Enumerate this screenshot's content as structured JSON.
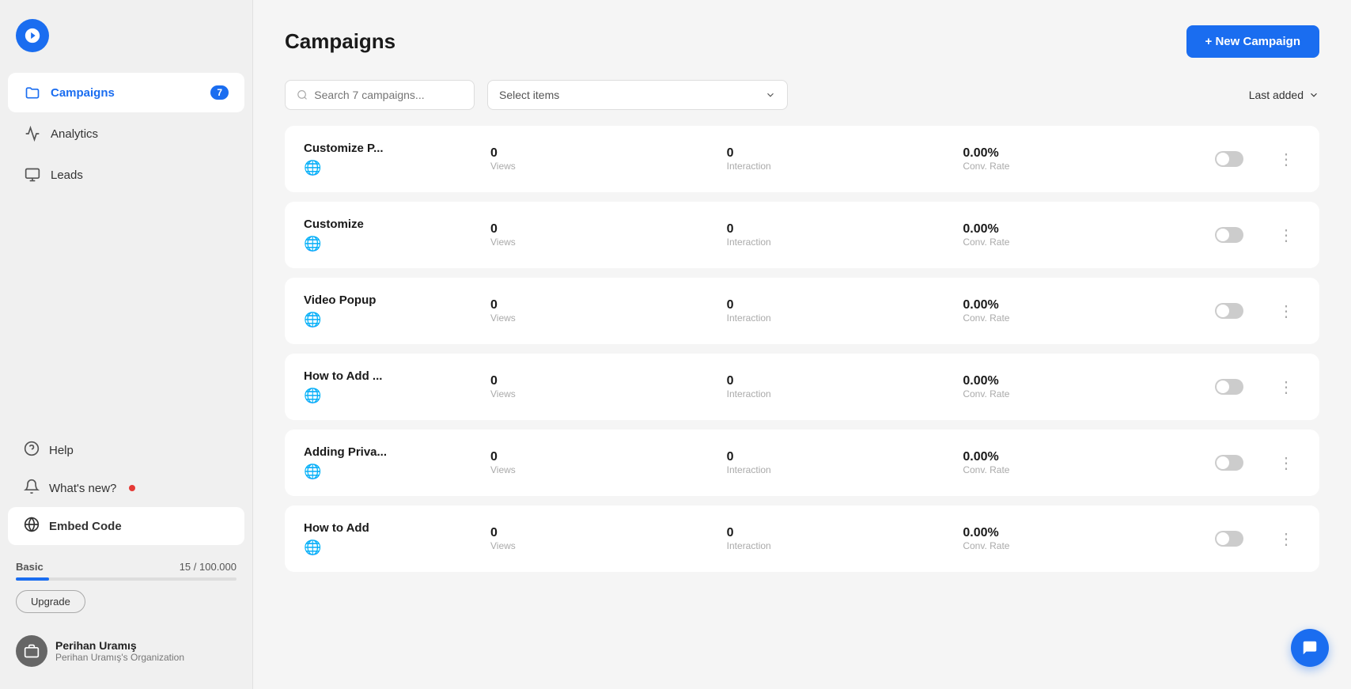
{
  "sidebar": {
    "logo_alt": "App Logo",
    "nav_items": [
      {
        "id": "campaigns",
        "label": "Campaigns",
        "icon": "folder-icon",
        "active": true,
        "badge": "7"
      },
      {
        "id": "analytics",
        "label": "Analytics",
        "icon": "analytics-icon",
        "active": false,
        "badge": null
      },
      {
        "id": "leads",
        "label": "Leads",
        "icon": "leads-icon",
        "active": false,
        "badge": null
      }
    ],
    "bottom_items": [
      {
        "id": "help",
        "label": "Help",
        "icon": "help-icon",
        "highlighted": false,
        "has_dot": false
      },
      {
        "id": "whats-new",
        "label": "What's new?",
        "icon": "bell-icon",
        "highlighted": false,
        "has_dot": true
      },
      {
        "id": "embed-code",
        "label": "Embed Code",
        "icon": "embed-icon",
        "highlighted": true,
        "has_dot": false
      }
    ],
    "plan": {
      "label": "Basic",
      "usage": "15 / 100.000",
      "progress_pct": 15,
      "upgrade_label": "Upgrade"
    },
    "user": {
      "name": "Perihan Uramış",
      "org": "Perihan Uramış's Organization"
    }
  },
  "header": {
    "title": "Campaigns",
    "new_campaign_label": "+ New Campaign"
  },
  "toolbar": {
    "search_placeholder": "Search 7 campaigns...",
    "select_placeholder": "Select items",
    "sort_label": "Last added"
  },
  "campaigns": [
    {
      "name": "Customize P...",
      "views": "0",
      "views_label": "Views",
      "interaction": "0",
      "interaction_label": "Interaction",
      "conv_rate": "0.00%",
      "conv_rate_label": "Conv. Rate"
    },
    {
      "name": "Customize",
      "views": "0",
      "views_label": "Views",
      "interaction": "0",
      "interaction_label": "Interaction",
      "conv_rate": "0.00%",
      "conv_rate_label": "Conv. Rate"
    },
    {
      "name": "Video Popup",
      "views": "0",
      "views_label": "Views",
      "interaction": "0",
      "interaction_label": "Interaction",
      "conv_rate": "0.00%",
      "conv_rate_label": "Conv. Rate"
    },
    {
      "name": "How to Add ...",
      "views": "0",
      "views_label": "Views",
      "interaction": "0",
      "interaction_label": "Interaction",
      "conv_rate": "0.00%",
      "conv_rate_label": "Conv. Rate"
    },
    {
      "name": "Adding Priva...",
      "views": "0",
      "views_label": "Views",
      "interaction": "0",
      "interaction_label": "Interaction",
      "conv_rate": "0.00%",
      "conv_rate_label": "Conv. Rate"
    },
    {
      "name": "How to Add",
      "views": "0",
      "views_label": "Views",
      "interaction": "0",
      "interaction_label": "Interaction",
      "conv_rate": "0.00%",
      "conv_rate_label": "Conv. Rate"
    }
  ]
}
